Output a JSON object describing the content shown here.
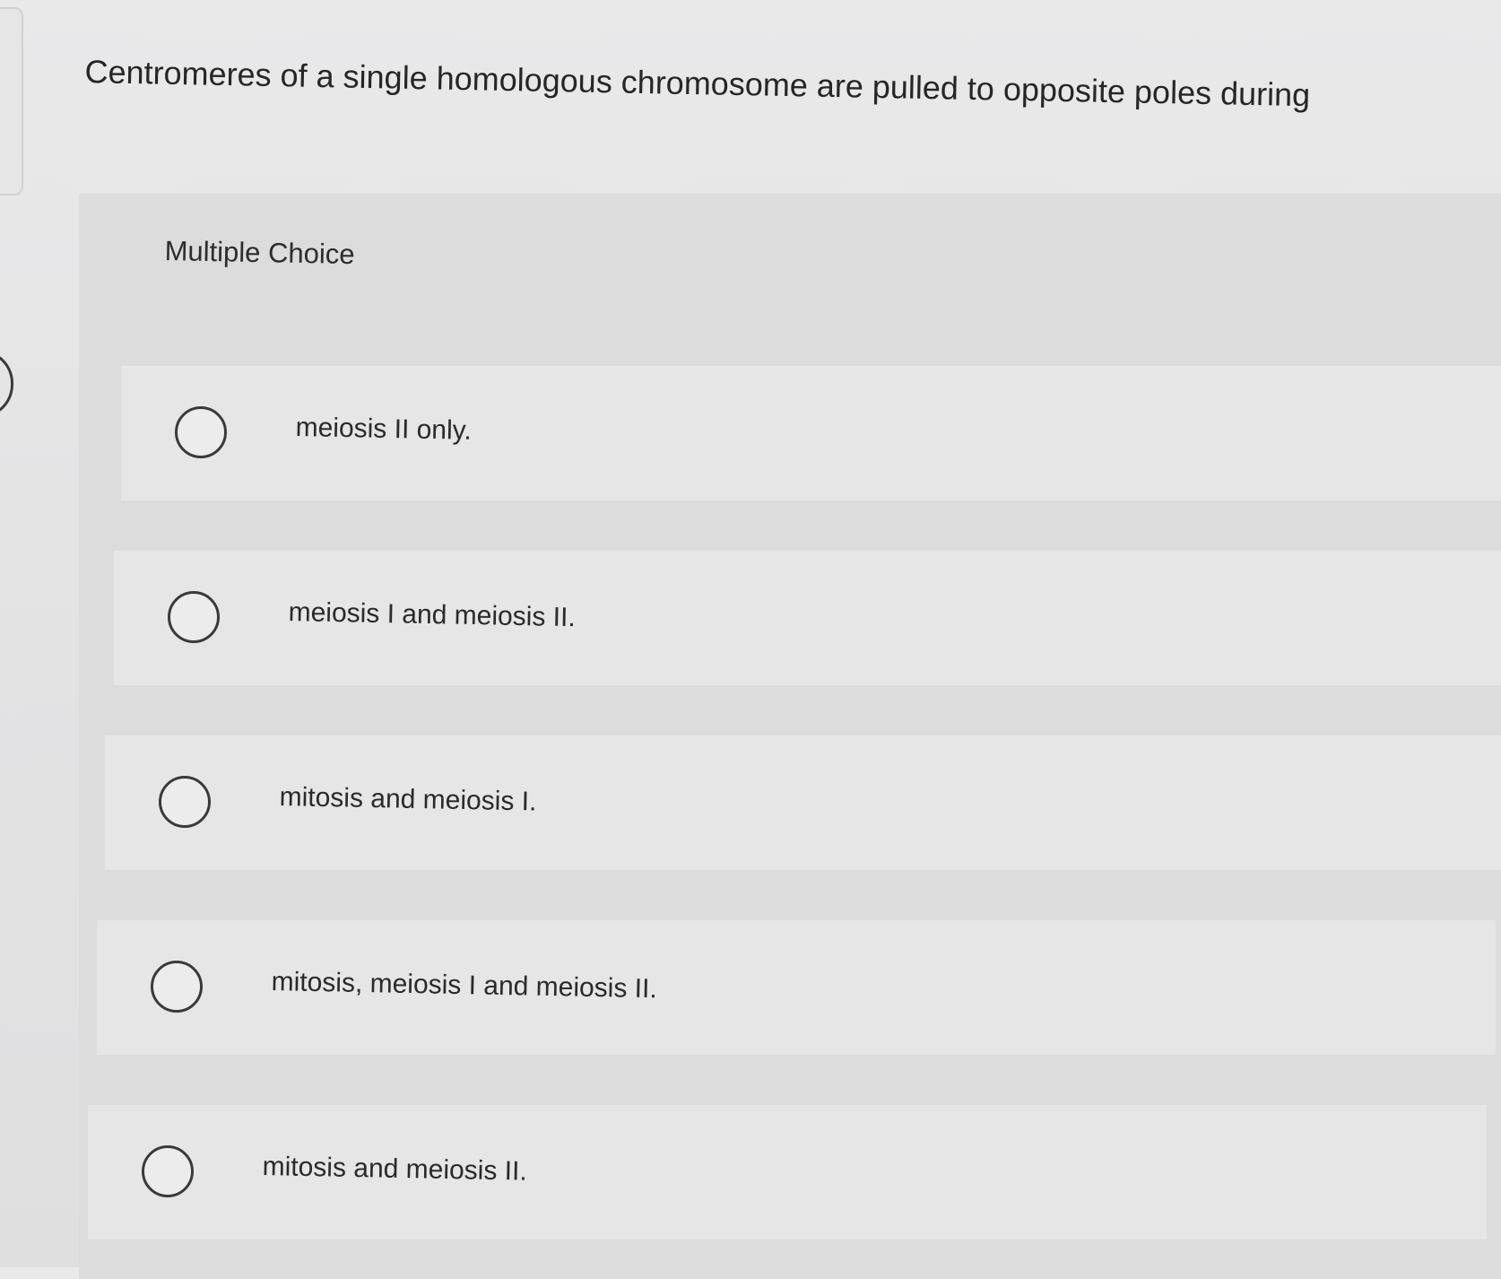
{
  "question": {
    "text": "Centromeres of a single homologous chromosome are pulled to opposite poles during"
  },
  "answer_section": {
    "label": "Multiple Choice",
    "options": [
      {
        "label": "meiosis II only.",
        "selected": false
      },
      {
        "label": "meiosis I and meiosis II.",
        "selected": false
      },
      {
        "label": "mitosis and meiosis I.",
        "selected": false
      },
      {
        "label": "mitosis, meiosis I and meiosis II.",
        "selected": false
      },
      {
        "label": "mitosis and meiosis II.",
        "selected": false
      }
    ]
  }
}
